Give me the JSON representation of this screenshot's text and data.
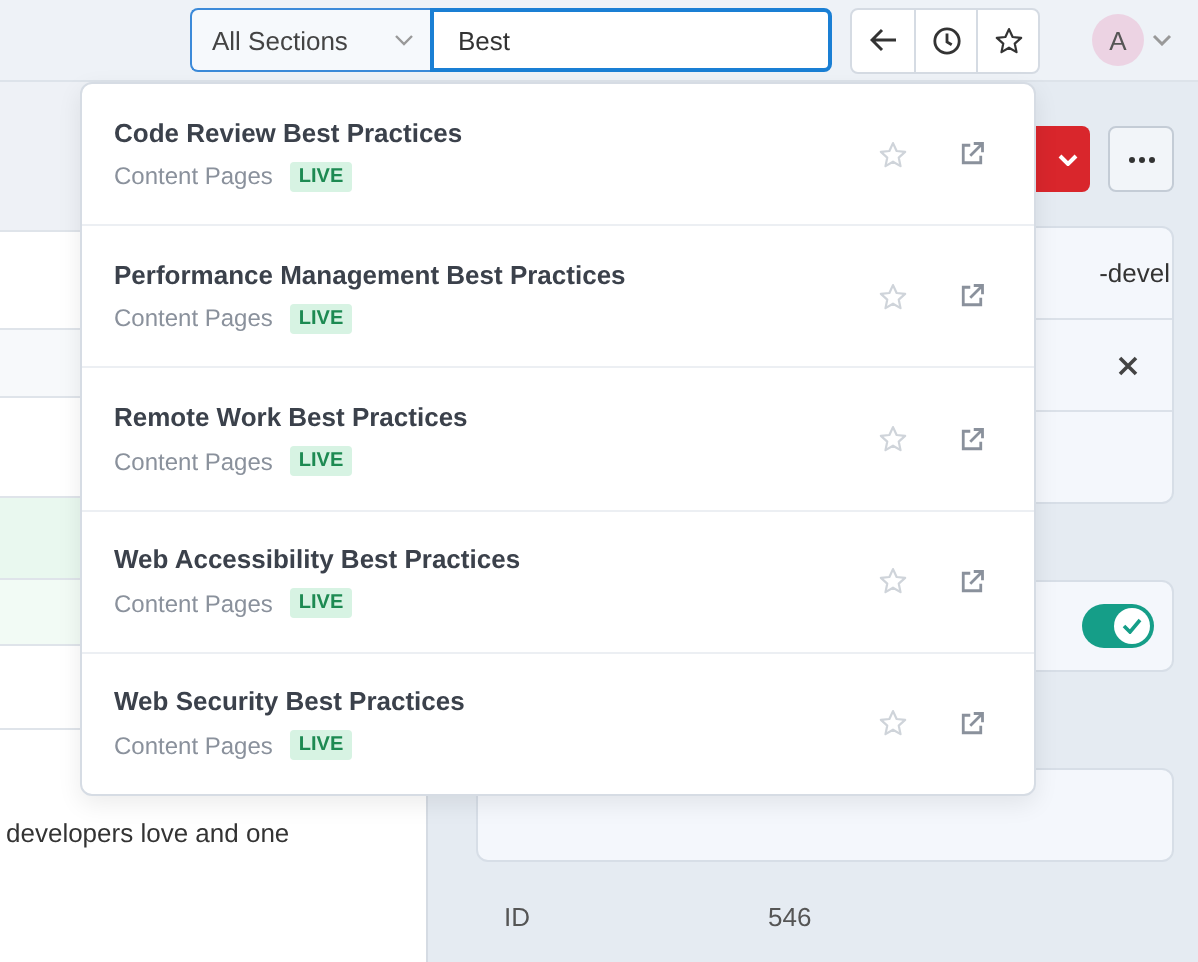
{
  "header": {
    "section_select": "All Sections",
    "search": {
      "value": "Best"
    },
    "avatar": "A"
  },
  "results": [
    {
      "title": "Code Review Best Practices",
      "section": "Content Pages",
      "status": "LIVE"
    },
    {
      "title": "Performance Management Best Practices",
      "section": "Content Pages",
      "status": "LIVE"
    },
    {
      "title": "Remote Work Best Practices",
      "section": "Content Pages",
      "status": "LIVE"
    },
    {
      "title": "Web Accessibility Best Practices",
      "section": "Content Pages",
      "status": "LIVE"
    },
    {
      "title": "Web Security Best Practices",
      "section": "Content Pages",
      "status": "LIVE"
    }
  ],
  "content": {
    "snippet": "developers love and one"
  },
  "side_panel": {
    "slug_fragment": "-devel",
    "toggle": {
      "on": true
    },
    "id_label": "ID",
    "id_value": "546"
  }
}
